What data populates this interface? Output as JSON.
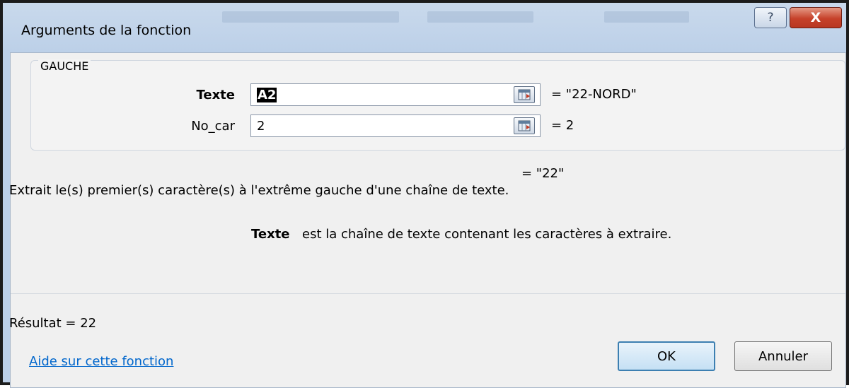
{
  "window": {
    "title": "Arguments de la fonction",
    "help_icon": "question-mark-icon",
    "close_icon": "close-icon",
    "close_label": "X"
  },
  "function_group": {
    "name": "GAUCHE",
    "arguments": [
      {
        "label": "Texte",
        "bold": true,
        "value": "A2",
        "result": "=  \"22-NORD\""
      },
      {
        "label": "No_car",
        "bold": false,
        "value": "2",
        "result": "=  2"
      }
    ]
  },
  "formula_result": "=  \"22\"",
  "description": "Extrait le(s) premier(s) caractère(s) à l'extrême gauche d'une chaîne de texte.",
  "argument_help": {
    "name": "Texte",
    "text": "est la chaîne de texte contenant les caractères à extraire."
  },
  "result": "Résultat =   22",
  "help_link": "Aide sur cette fonction",
  "buttons": {
    "ok": "OK",
    "cancel": "Annuler"
  }
}
